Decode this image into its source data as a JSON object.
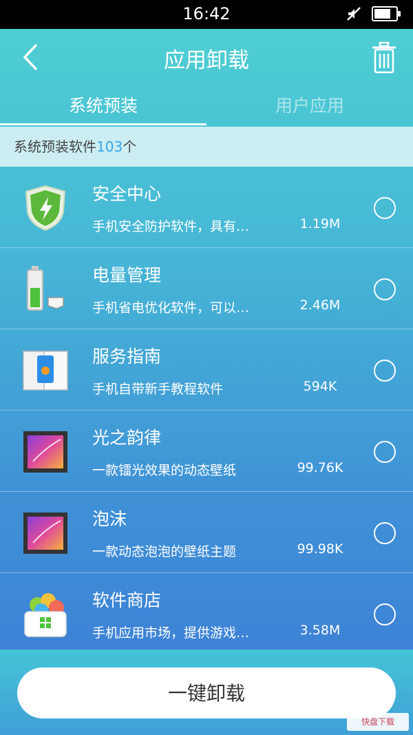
{
  "status_bar": {
    "time": "16:42"
  },
  "header": {
    "title": "应用卸载"
  },
  "tabs": [
    {
      "label": "系统预装"
    },
    {
      "label": "用户应用"
    }
  ],
  "count": {
    "prefix": "系统预装软件",
    "number": "103",
    "suffix": "个"
  },
  "apps": [
    {
      "name": "安全中心",
      "desc": "手机安全防护软件，具有…",
      "size": "1.19M",
      "icon": "shield-icon"
    },
    {
      "name": "电量管理",
      "desc": "手机省电优化软件，可以…",
      "size": "2.46M",
      "icon": "battery-icon"
    },
    {
      "name": "服务指南",
      "desc": "手机自带新手教程软件",
      "size": "594K",
      "icon": "guide-icon"
    },
    {
      "name": "光之韵律",
      "desc": "一款镭光效果的动态壁纸",
      "size": "99.76K",
      "icon": "wallpaper-icon"
    },
    {
      "name": "泡沫",
      "desc": "一款动态泡泡的壁纸主题",
      "size": "99.98K",
      "icon": "wallpaper-icon"
    },
    {
      "name": "软件商店",
      "desc": "手机应用市场，提供游戏…",
      "size": "3.58M",
      "icon": "store-icon"
    }
  ],
  "actions": {
    "uninstall_label": "一键卸载"
  },
  "watermark": {
    "text": "快盘下载"
  },
  "colors": {
    "accent": "#3aa6e5",
    "header_top": "#4fd2d2",
    "header_bottom": "#3d7bd5"
  }
}
